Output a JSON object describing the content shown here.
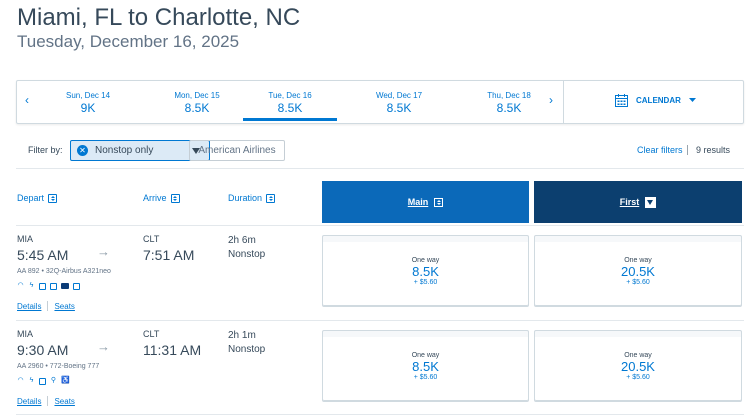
{
  "header": {
    "route": "Miami, FL to Charlotte, NC",
    "date": "Tuesday, December 16, 2025"
  },
  "datebar": {
    "prev_arrow": "‹",
    "next_arrow": "›",
    "dates": [
      {
        "day": "Sun, Dec 14",
        "price": "9K"
      },
      {
        "day": "Mon, Dec 15",
        "price": "8.5K"
      },
      {
        "day": "Tue, Dec 16",
        "price": "8.5K",
        "selected": true
      },
      {
        "day": "Wed, Dec 17",
        "price": "8.5K"
      },
      {
        "day": "Thu, Dec 18",
        "price": "8.5K"
      }
    ],
    "calendar_label": "CALENDAR"
  },
  "filters": {
    "label": "Filter by:",
    "active_chip": "Nonstop only",
    "airline_chip": "American Airlines",
    "clear": "Clear filters",
    "results": "9 results"
  },
  "columns": {
    "depart": "Depart",
    "arrive": "Arrive",
    "duration": "Duration",
    "main": "Main",
    "first": "First"
  },
  "flights": [
    {
      "origin": "MIA",
      "depart_time": "5:45 AM",
      "dest": "CLT",
      "arrive_time": "7:51 AM",
      "duration": "2h 6m",
      "stops": "Nonstop",
      "flight_info": "AA 892 • 32Q-Airbus A321neo",
      "details": "Details",
      "seats": "Seats",
      "main": {
        "label": "One way",
        "points": "8.5K",
        "tax": "+ $5.60"
      },
      "first": {
        "label": "One way",
        "points": "20.5K",
        "tax": "+ $5.60"
      }
    },
    {
      "origin": "MIA",
      "depart_time": "9:30 AM",
      "dest": "CLT",
      "arrive_time": "11:31 AM",
      "duration": "2h 1m",
      "stops": "Nonstop",
      "flight_info": "AA 2960 • 772-Boeing 777",
      "details": "Details",
      "seats": "Seats",
      "main": {
        "label": "One way",
        "points": "8.5K",
        "tax": "+ $5.60"
      },
      "first": {
        "label": "One way",
        "points": "20.5K",
        "tax": "+ $5.60"
      }
    }
  ],
  "colors": {
    "link": "#0078d2",
    "main_header": "#0b69b9",
    "first_header": "#0c3f6f",
    "text": "#36495a"
  }
}
